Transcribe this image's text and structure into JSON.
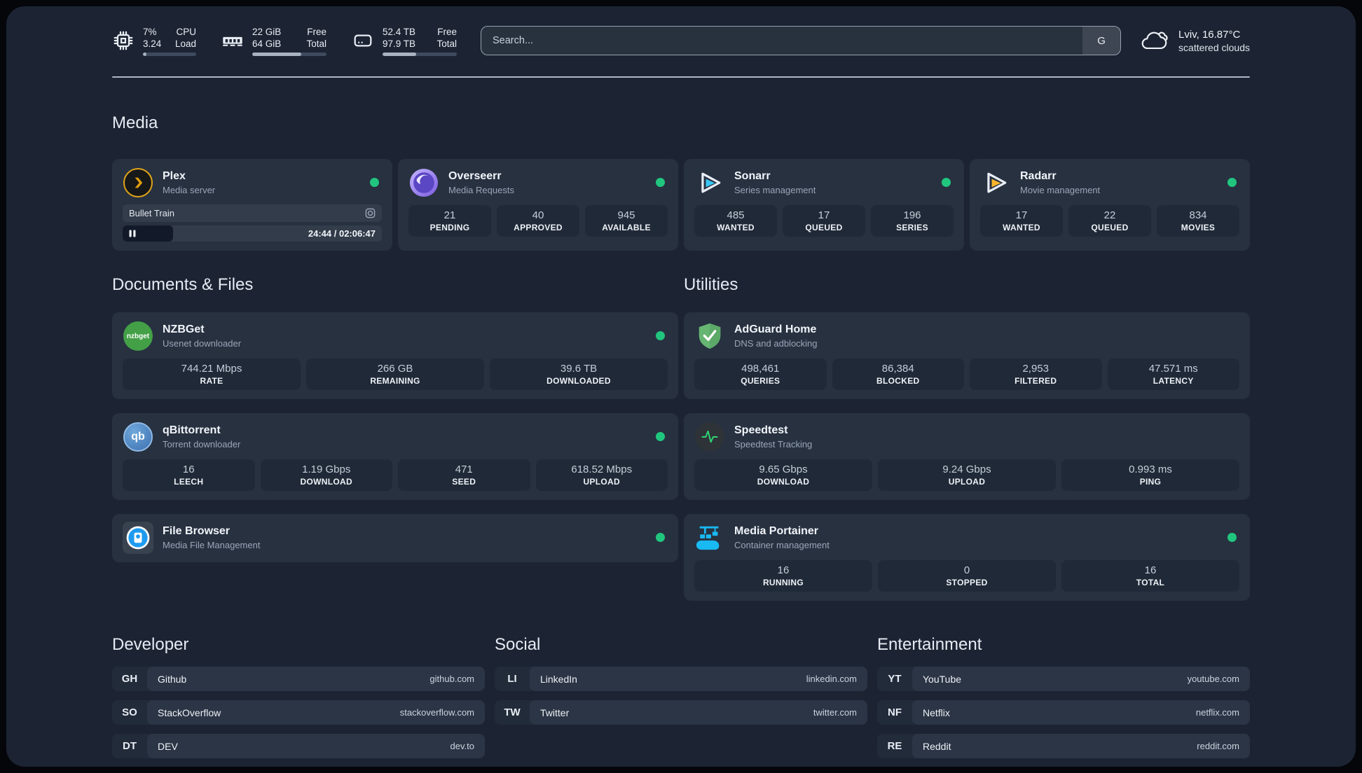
{
  "colors": {
    "accent_green": "#21C67E",
    "page_bg": "#1C2433",
    "card_bg": "#273140"
  },
  "topbar": {
    "stats": [
      {
        "icon": "cpu-icon",
        "rows": [
          {
            "left": "7%",
            "right": "CPU"
          },
          {
            "left": "3.24",
            "right": "Load"
          }
        ],
        "progress": 7
      },
      {
        "icon": "ram-icon",
        "rows": [
          {
            "left": "22 GiB",
            "right": "Free"
          },
          {
            "left": "64 GiB",
            "right": "Total"
          }
        ],
        "progress": 66
      },
      {
        "icon": "disk-icon",
        "rows": [
          {
            "left": "52.4 TB",
            "right": "Free"
          },
          {
            "left": "97.9 TB",
            "right": "Total"
          }
        ],
        "progress": 45
      }
    ],
    "search": {
      "placeholder": "Search...",
      "button_label": "G"
    },
    "weather": {
      "location": "Lviv, 16.87°C",
      "condition": "scattered clouds"
    }
  },
  "media": {
    "title": "Media",
    "plex": {
      "name": "Plex",
      "subtitle": "Media server",
      "player": {
        "title": "Bullet Train",
        "time": "24:44 / 02:06:47",
        "progress": 19.5
      }
    },
    "overseerr": {
      "name": "Overseerr",
      "subtitle": "Media Requests",
      "stats": [
        {
          "value": "21",
          "label": "PENDING"
        },
        {
          "value": "40",
          "label": "APPROVED"
        },
        {
          "value": "945",
          "label": "AVAILABLE"
        }
      ]
    },
    "sonarr": {
      "name": "Sonarr",
      "subtitle": "Series management",
      "stats": [
        {
          "value": "485",
          "label": "WANTED"
        },
        {
          "value": "17",
          "label": "QUEUED"
        },
        {
          "value": "196",
          "label": "SERIES"
        }
      ]
    },
    "radarr": {
      "name": "Radarr",
      "subtitle": "Movie management",
      "stats": [
        {
          "value": "17",
          "label": "WANTED"
        },
        {
          "value": "22",
          "label": "QUEUED"
        },
        {
          "value": "834",
          "label": "MOVIES"
        }
      ]
    }
  },
  "documents": {
    "title": "Documents & Files",
    "nzbget": {
      "name": "NZBGet",
      "subtitle": "Usenet downloader",
      "logo_text": "nzbget",
      "stats": [
        {
          "value": "744.21 Mbps",
          "label": "RATE"
        },
        {
          "value": "266 GB",
          "label": "REMAINING"
        },
        {
          "value": "39.6 TB",
          "label": "DOWNLOADED"
        }
      ]
    },
    "qbittorrent": {
      "name": "qBittorrent",
      "subtitle": "Torrent downloader",
      "logo_text": "qb",
      "stats": [
        {
          "value": "16",
          "label": "LEECH"
        },
        {
          "value": "1.19 Gbps",
          "label": "DOWNLOAD"
        },
        {
          "value": "471",
          "label": "SEED"
        },
        {
          "value": "618.52 Mbps",
          "label": "UPLOAD"
        }
      ]
    },
    "filebrowser": {
      "name": "File Browser",
      "subtitle": "Media File Management"
    }
  },
  "utilities": {
    "title": "Utilities",
    "adguard": {
      "name": "AdGuard Home",
      "subtitle": "DNS and adblocking",
      "stats": [
        {
          "value": "498,461",
          "label": "QUERIES"
        },
        {
          "value": "86,384",
          "label": "BLOCKED"
        },
        {
          "value": "2,953",
          "label": "FILTERED"
        },
        {
          "value": "47.571 ms",
          "label": "LATENCY"
        }
      ]
    },
    "speedtest": {
      "name": "Speedtest",
      "subtitle": "Speedtest Tracking",
      "stats": [
        {
          "value": "9.65 Gbps",
          "label": "DOWNLOAD"
        },
        {
          "value": "9.24 Gbps",
          "label": "UPLOAD"
        },
        {
          "value": "0.993 ms",
          "label": "PING"
        }
      ]
    },
    "portainer": {
      "name": "Media Portainer",
      "subtitle": "Container management",
      "stats": [
        {
          "value": "16",
          "label": "RUNNING"
        },
        {
          "value": "0",
          "label": "STOPPED"
        },
        {
          "value": "16",
          "label": "TOTAL"
        }
      ]
    }
  },
  "bookmarks": {
    "developer": {
      "title": "Developer",
      "links": [
        {
          "abbr": "GH",
          "name": "Github",
          "url": "github.com"
        },
        {
          "abbr": "SO",
          "name": "StackOverflow",
          "url": "stackoverflow.com"
        },
        {
          "abbr": "DT",
          "name": "DEV",
          "url": "dev.to"
        }
      ]
    },
    "social": {
      "title": "Social",
      "links": [
        {
          "abbr": "LI",
          "name": "LinkedIn",
          "url": "linkedin.com"
        },
        {
          "abbr": "TW",
          "name": "Twitter",
          "url": "twitter.com"
        }
      ]
    },
    "entertainment": {
      "title": "Entertainment",
      "links": [
        {
          "abbr": "YT",
          "name": "YouTube",
          "url": "youtube.com"
        },
        {
          "abbr": "NF",
          "name": "Netflix",
          "url": "netflix.com"
        },
        {
          "abbr": "RE",
          "name": "Reddit",
          "url": "reddit.com"
        }
      ]
    }
  }
}
